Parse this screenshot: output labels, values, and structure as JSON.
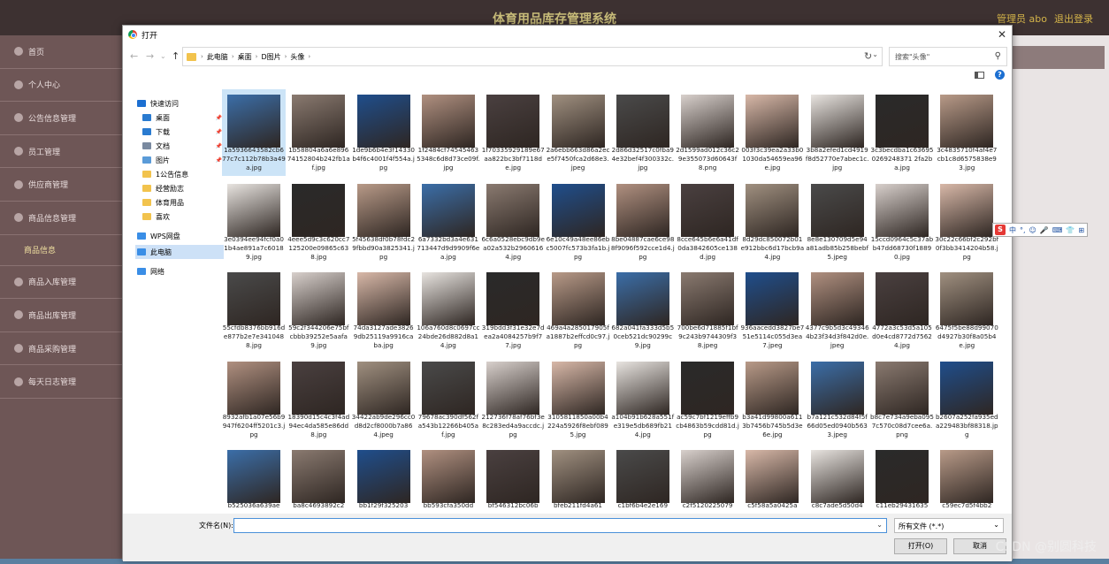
{
  "app": {
    "title": "体育用品库存管理系统",
    "user": "管理员 abo",
    "logout": "退出登录"
  },
  "sidebar": [
    {
      "label": "首页"
    },
    {
      "label": "个人中心"
    },
    {
      "label": "公告信息管理"
    },
    {
      "label": "员工管理"
    },
    {
      "label": "供应商管理"
    },
    {
      "label": "商品信息管理"
    }
  ],
  "sidebar_sub": "商品信息",
  "sidebar_bottom": [
    {
      "label": "商品入库管理"
    },
    {
      "label": "商品出库管理"
    },
    {
      "label": "商品采购管理"
    },
    {
      "label": "每天日志管理"
    }
  ],
  "dialog": {
    "title": "打开",
    "breadcrumb": [
      "此电脑",
      "桌面",
      "D图片",
      "头像"
    ],
    "search_placeholder": "搜索\"头像\"",
    "filename_label": "文件名(N):",
    "filename_value": "",
    "filetype": "所有文件 (*.*)",
    "open_button": "打开(O)",
    "cancel_button": "取消"
  },
  "nav": [
    {
      "label": "快速访问",
      "icon": "star-icon",
      "color": "#1c6fd1"
    },
    {
      "label": "桌面",
      "icon": "desktop-icon",
      "color": "#2a7bd0",
      "pin": true
    },
    {
      "label": "下载",
      "icon": "download-icon",
      "color": "#2a7bd0",
      "pin": true
    },
    {
      "label": "文档",
      "icon": "document-icon",
      "color": "#7a8aa0",
      "pin": true
    },
    {
      "label": "图片",
      "icon": "pictures-icon",
      "color": "#5a9bd8",
      "pin": true
    },
    {
      "label": "1公告信息",
      "icon": "folder-icon",
      "color": "#f2c34d"
    },
    {
      "label": "经营励志",
      "icon": "folder-icon",
      "color": "#f2c34d"
    },
    {
      "label": "体育用品",
      "icon": "folder-icon",
      "color": "#f2c34d"
    },
    {
      "label": "喜欢",
      "icon": "folder-icon",
      "color": "#f2c34d"
    },
    {
      "label": "WPS网盘",
      "icon": "cloud-icon",
      "color": "#3a8ee6"
    },
    {
      "label": "此电脑",
      "icon": "computer-icon",
      "color": "#3a8ee6",
      "selected": true
    },
    {
      "label": "网络",
      "icon": "network-icon",
      "color": "#3a8ee6"
    }
  ],
  "files": [
    "1a5936643582cb677c7c112b78b3a49a.jpg",
    "1b58804a6a6e89674152804b242fb1af.jpg",
    "1de9b6b4e3f14330b4f6c4001f4f554a.jpg",
    "1f2484cf745454635348c6d8d73ce09f.jpg",
    "1f70335929189e67aa822bc3bf7118de.jpg",
    "2a6ebb663d86a2ece5f7450fca2d68e3.jpeg",
    "2d86d32517c0fba94e32bef4f300332c.jpg",
    "2d1599ad012c36c29e355073d60643f8.png",
    "003f3c39ea2a33b01030da54659ea96e.jpg",
    "3b8a2efed1cd4919f8d52770e7abec1c.jpg",
    "3c3becdba1c636950269248371 2fa2ba.jpg",
    "3c4835710f4af4e7cb1c8d6575838e93.jpg",
    "3e0394ee94fcf0a01b4ae891a7c60189.jpg",
    "4eee5d9c3c620cc7125200e09865c638.jpg",
    "5f45638df0b78fdc29fbbd90a3825341.jpg",
    "6a7332bd3a4e631713447d9d9909f6ea.jpg",
    "6c6a0528ebc9db9ea02a532b29606164.jpg",
    "6e10c49a48ee86ebc5007fc573b3fa1b.jpg",
    "8be04887cae6ce988f9096f592cce1d4.jpg",
    "8cce645b6e6a41df0da3842605ce138d.jpg",
    "8d29dc850072b01e912bbc6d17bcb9a4.jpg",
    "8e8e130709d5e94a81adb85b258bebf5.jpeg",
    "15ccd0964c5c37abb47dd68730f18890.jpg",
    "30c22c66bf2c292bf0f3bb3414204b58.jpg",
    "55cfdb8376bb916de877b2e7e3410488.jpg",
    "59c2f344206e75bfcbbb39252e5aafa9.jpg",
    "74da3127ade38269db25119a9916caba.jpg",
    "106a760d8c0697cc24bde26d882d8a14.jpg",
    "319bdd3f31e32e7dea2a4084257b9f77.jpg",
    "469a4a285017905fa1887b2effcd0c97.jpg",
    "682a041fa333d5b50ceb521dc90299c9.jpg",
    "700be6d71885f1bf9c243b9744309f38.jpeg",
    "936aacedd3827be751e5114c055d3ea7.jpeg",
    "4377c9b5d3c493464b23f34d3f842d0e.jpeg",
    "4772a3c53d5a105d0e4cd8772d75624.jpg",
    "6475f5be88d99070d4927b30f8a05b4e.jpg",
    "8932afb1a07e56b9947f6204ff5201c3.jpg",
    "18390d15c4c3f4ad94ec4da585e86dd8.jpg",
    "34422ab9de296cc0d8d2cf8000b7a864.jpeg",
    "79678ac390df562fa543b12266b405af.jpg",
    "212736f78af76bf3e8c283ed4a9accdc.jpg",
    "3105811850a00b4224a5926f8ebf0895.jpg",
    "a104b91b628a551fe319e5db689fb214.jpg",
    "ac59c7bf1219effb9cb4863b59cdd81d.jpg",
    "b3a41d99800a6113b7456b745b5d3e6e.jpg",
    "b7a121c532d84f5f66d05ed0940b5633.jpeg",
    "b8c7e734a9eba0957c570c08d7cee6a.png",
    "b2607a252fa935eda229483bf88318.jpg",
    "b525036a639ae",
    "ba8c4693892c2",
    "bb1f29f325203",
    "bb593cfa350dd",
    "bf546312bc06b",
    "bfeb211fd4a61",
    "c1bf6b4e2e169",
    "c2f5120225079",
    "c5f58a5a0425a",
    "c8c7ade5d50d4",
    "c11eb29431635",
    "c59ec7d5f4bb2"
  ],
  "thumb_colors": [
    "#3b6ea8",
    "#d8d0cc",
    "#1f4e8c",
    "#e8e4e0",
    "#4a4040",
    "#b89a88",
    "#4a4a4a",
    "#8a7a70",
    "#d8b8a8",
    "#b09080",
    "#2a2a2a",
    "#a09080"
  ],
  "watermark": "CSDN @别圆科技",
  "ime": {
    "logo": "S",
    "items": [
      "中",
      "°,",
      "☺",
      "🎤",
      "⌨",
      "👕",
      "⊞"
    ]
  }
}
